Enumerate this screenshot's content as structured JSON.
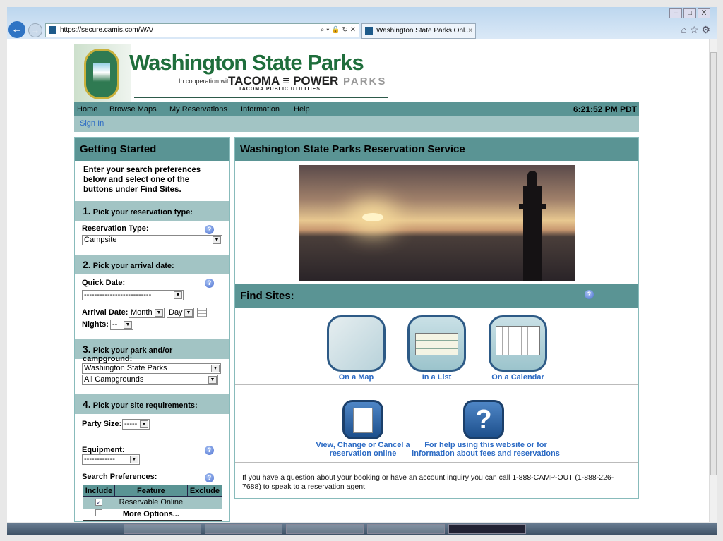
{
  "browser": {
    "url": "https://secure.camis.com/WA/",
    "tab_title": "Washington State Parks Onl...",
    "tab_close": "×",
    "win_buttons": [
      "–",
      "□",
      "X"
    ],
    "right_icons": "⌂☆⚙"
  },
  "header": {
    "title": "Washington State Parks",
    "coop": "In cooperation with",
    "tacoma": "TACOMA ≡ POWER",
    "parks": "PARKS",
    "tpu": "TACOMA PUBLIC UTILITIES"
  },
  "nav": {
    "items": [
      "Home",
      "Browse Maps",
      "My Reservations",
      "Information",
      "Help"
    ],
    "time": "6:21:52 PM PDT",
    "sign_in": "Sign In"
  },
  "left": {
    "title": "Getting Started",
    "intro": "Enter your search preferences below and select one of the buttons under Find Sites.",
    "s1": {
      "num": "1.",
      "label": "Pick your reservation type:",
      "field": "Reservation Type:",
      "value": "Campsite"
    },
    "s2": {
      "num": "2.",
      "label": "Pick your arrival date:",
      "quick": "Quick Date:",
      "quick_value": "--------------------------",
      "arrival": "Arrival Date:",
      "month": "Month",
      "day": "Day",
      "nights": "Nights:",
      "nights_value": "--"
    },
    "s3": {
      "num": "3.",
      "label": "Pick your park and/or campground:",
      "park": "Washington State Parks",
      "campground": "All Campgrounds"
    },
    "s4": {
      "num": "4.",
      "label": "Pick your site requirements:",
      "party": "Party Size:",
      "party_value": "-----",
      "equipment": "Equipment:",
      "equipment_value": "------------",
      "prefs": "Search Preferences:",
      "table": {
        "headers": [
          "Include",
          "Feature",
          "Exclude"
        ],
        "rows": [
          {
            "feature": "Reservable Online",
            "checked": true
          },
          {
            "feature": "More Options...",
            "checked": false
          }
        ]
      }
    }
  },
  "right": {
    "title": "Washington State Parks Reservation Service",
    "find": "Find Sites:",
    "map": "On a Map",
    "list": "In a List",
    "calendar": "On a Calendar",
    "view": "View, Change or Cancel a reservation online",
    "help": "For help using this website or for information about fees and reservations",
    "phone": "If you have a question about your booking or have an account inquiry you can call 1-888-CAMP-OUT (1-888-226-7688) to speak to a reservation agent.",
    "check": "✓",
    "help_glyph": "?"
  }
}
